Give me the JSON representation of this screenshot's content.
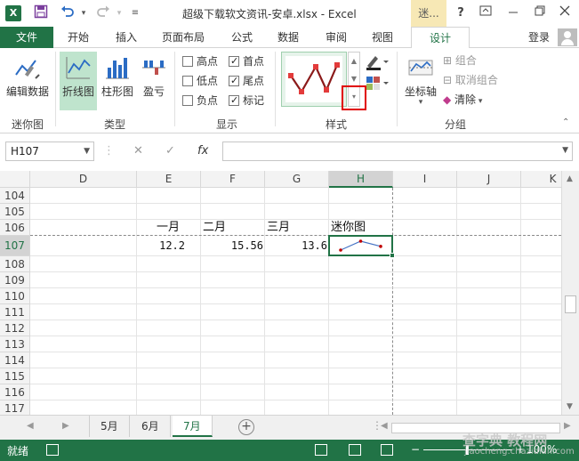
{
  "titlebar": {
    "app_icon": "excel-logo-icon",
    "logo_letter": "X",
    "title": "超级下载软文资讯-安卓.xlsx - Excel",
    "context_tab": "迷...",
    "help": "?",
    "save_icon": "save-icon",
    "undo_icon": "undo-icon",
    "redo_icon": "redo-icon"
  },
  "tabs": {
    "file": "文件",
    "items": [
      "开始",
      "插入",
      "页面布局",
      "公式",
      "数据",
      "审阅",
      "视图",
      "设计"
    ],
    "active": "设计",
    "login": "登录"
  },
  "ribbon": {
    "groups": {
      "sparkline": "迷你图",
      "type": "类型",
      "show": "显示",
      "style": "样式",
      "group": "分组"
    },
    "edit_data": "编辑数据",
    "line": "折线图",
    "column": "柱形图",
    "winloss": "盈亏",
    "checkboxes": [
      {
        "label": "高点",
        "checked": false
      },
      {
        "label": "首点",
        "checked": true
      },
      {
        "label": "低点",
        "checked": false
      },
      {
        "label": "尾点",
        "checked": true
      },
      {
        "label": "负点",
        "checked": false
      },
      {
        "label": "标记",
        "checked": true
      }
    ],
    "axis": "坐标轴",
    "group_btn": "组合",
    "ungroup": "取消组合",
    "clear": "清除",
    "style_color": "#8b1a1a",
    "marker_color": "#e33b3b",
    "highlight_color": "#e00000"
  },
  "formulabar": {
    "namebox": "H107",
    "cancel": "✕",
    "enter": "✓",
    "fx": "fx",
    "value": ""
  },
  "grid": {
    "columns": [
      "D",
      "E",
      "F",
      "G",
      "H",
      "I",
      "J",
      "K"
    ],
    "selected_col": "H",
    "rows": [
      "104",
      "105",
      "106",
      "107",
      "108",
      "109",
      "110",
      "111",
      "112",
      "113",
      "114",
      "115",
      "116",
      "117"
    ],
    "selected_row": "107",
    "headers": {
      "e": "一月",
      "f": "二月",
      "g": "三月",
      "h": "迷你图"
    },
    "values": {
      "e": "12.2",
      "f": "15.56",
      "g": "13.6"
    },
    "sparkline_values": [
      12.2,
      15.56,
      13.6
    ],
    "sparkline_color": "#4472c4",
    "marker_color": "#c00000"
  },
  "sheets": {
    "tabs": [
      "5月",
      "6月",
      "7月"
    ],
    "active": "7月"
  },
  "status": {
    "ready": "就绪",
    "zoom": "100%",
    "accent": "#217346"
  },
  "watermark": {
    "line1": "查字典 教程网",
    "line2": "jiaocheng.chazidian.com"
  }
}
